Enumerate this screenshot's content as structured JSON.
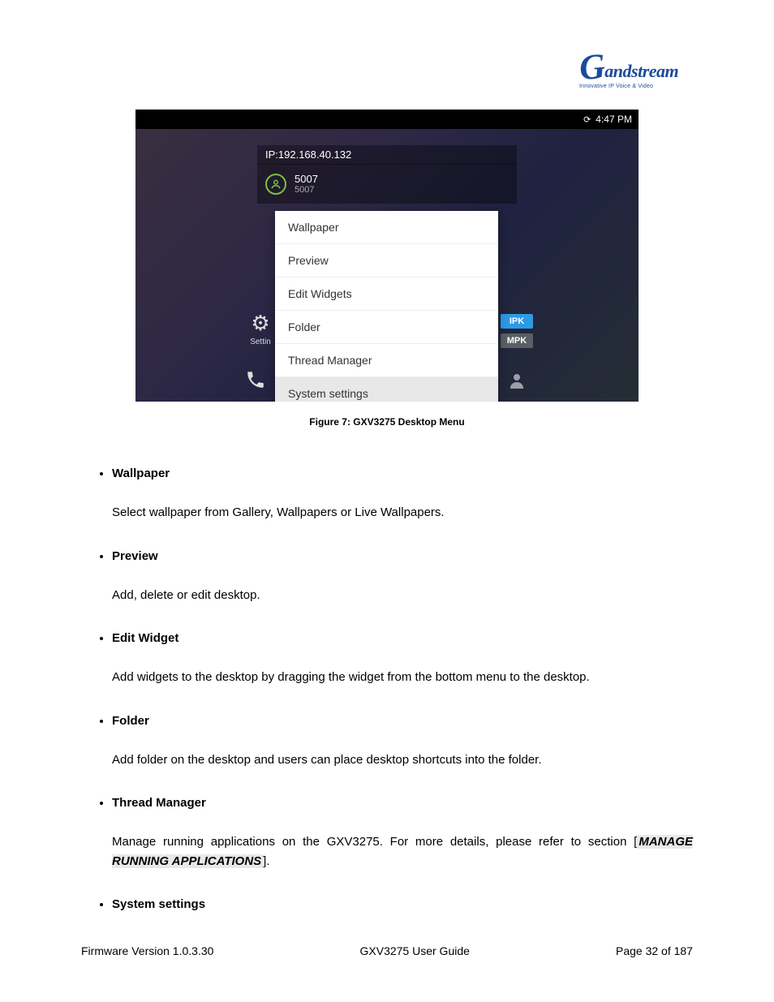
{
  "logo": {
    "brand": "andstream",
    "tagline": "Innovative IP Voice & Video"
  },
  "screenshot": {
    "status_time": "4:47 PM",
    "ip_label": "IP:192.168.40.132",
    "account": {
      "name": "5007",
      "sub": "5007"
    },
    "menu_items": [
      "Wallpaper",
      "Preview",
      "Edit Widgets",
      "Folder",
      "Thread Manager",
      "System settings"
    ],
    "bg_settings_label": "Settin",
    "mpk1": "IPK",
    "mpk2": "MPK"
  },
  "figure_caption": "Figure 7: GXV3275 Desktop Menu",
  "bullets": [
    {
      "title": "Wallpaper",
      "desc": "Select wallpaper from Gallery, Wallpapers or Live Wallpapers."
    },
    {
      "title": "Preview",
      "desc": "Add, delete or edit desktop."
    },
    {
      "title": "Edit Widget",
      "desc": "Add widgets to the desktop by dragging the widget from the bottom menu to the desktop."
    },
    {
      "title": "Folder",
      "desc": "Add folder on the desktop and users can place desktop shortcuts into the folder."
    },
    {
      "title": "Thread Manager",
      "desc_pre": "Manage running applications on the GXV3275. For more details, please refer to section [",
      "ref": "MANAGE RUNNING APPLICATIONS",
      "desc_post": "]."
    },
    {
      "title": "System settings",
      "desc": ""
    }
  ],
  "footer": {
    "left": "Firmware Version 1.0.3.30",
    "center": "GXV3275 User Guide",
    "right": "Page 32 of 187"
  }
}
